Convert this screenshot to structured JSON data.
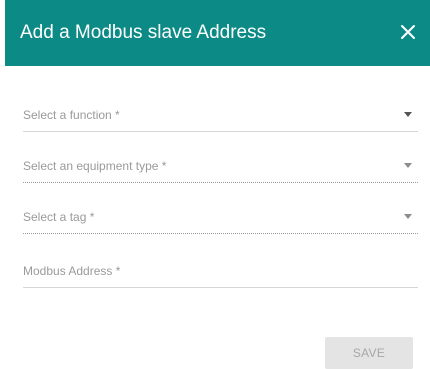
{
  "dialog": {
    "title": "Add a Modbus slave Address",
    "close_icon": "close-icon",
    "header_color": "#0c8a86"
  },
  "form": {
    "function_placeholder": "Select a function *",
    "equipment_type_placeholder": "Select an equipment type *",
    "tag_placeholder": "Select a tag *",
    "modbus_address_placeholder": "Modbus Address *"
  },
  "actions": {
    "save_label": "SAVE"
  }
}
